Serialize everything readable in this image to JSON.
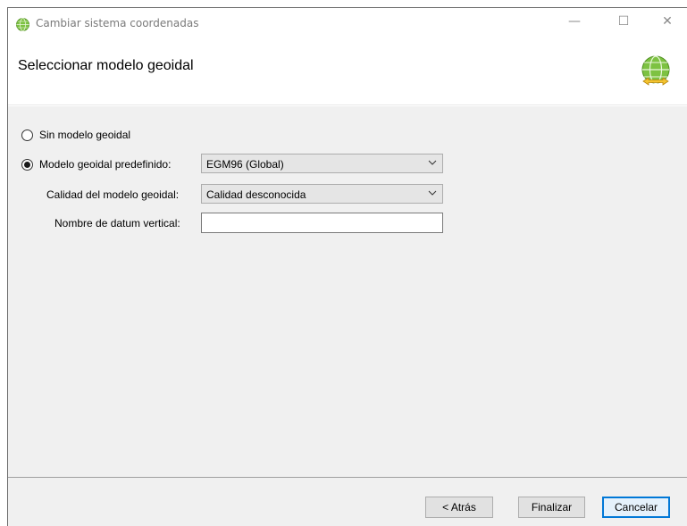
{
  "window": {
    "title": "Cambiar sistema coordenadas",
    "controls": {
      "minimize": "—",
      "maximize": "☐",
      "close": "✕"
    }
  },
  "header": {
    "title": "Seleccionar modelo geoidal",
    "icon": "globe-wizard-icon"
  },
  "options": {
    "no_geoid": {
      "label": "Sin modelo geoidal",
      "selected": false
    },
    "predefined": {
      "label": "Modelo geoidal predefinido:",
      "selected": true,
      "value": "EGM96 (Global)"
    },
    "quality": {
      "label": "Calidad del modelo geoidal:",
      "value": "Calidad desconocida"
    },
    "vertical_datum": {
      "label": "Nombre de datum vertical:",
      "value": ""
    }
  },
  "buttons": {
    "back": "< Atrás",
    "finish": "Finalizar",
    "cancel": "Cancelar"
  },
  "colors": {
    "accent": "#0078d7",
    "panel": "#f0f0f0",
    "globe": "#7dc242"
  }
}
